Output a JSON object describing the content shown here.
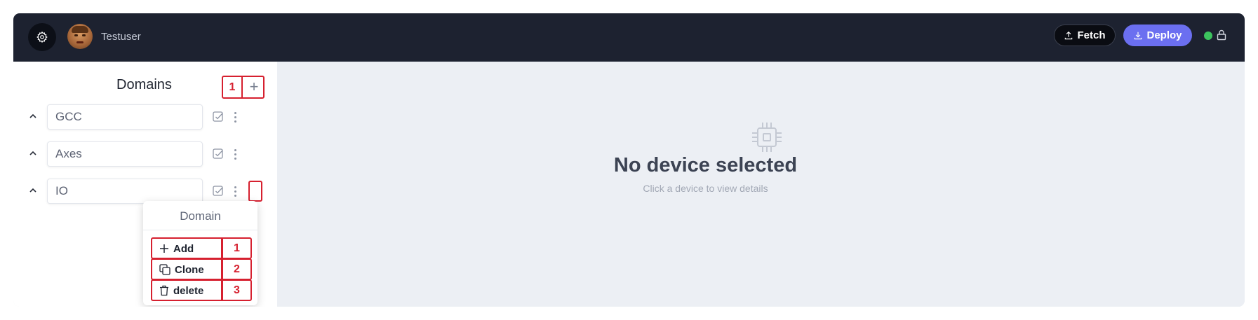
{
  "header": {
    "username": "Testuser",
    "fetch_label": "Fetch",
    "deploy_label": "Deploy",
    "status_color": "#3cc45e",
    "deploy_color": "#6b6ff0"
  },
  "sidebar": {
    "title": "Domains",
    "title_annotation": "1",
    "add_icon": "plus-icon",
    "domains": [
      {
        "name": "GCC"
      },
      {
        "name": "Axes"
      },
      {
        "name": "IO"
      }
    ]
  },
  "context_menu": {
    "title": "Domain",
    "items": [
      {
        "label": "Add",
        "icon": "plus-icon",
        "annotation": "1"
      },
      {
        "label": "Clone",
        "icon": "clone-icon",
        "annotation": "2"
      },
      {
        "label": "delete",
        "icon": "trash-icon",
        "annotation": "3"
      }
    ]
  },
  "main": {
    "empty_title": "No device selected",
    "empty_subtitle": "Click a device to view details",
    "empty_icon": "chip-icon"
  },
  "annotation_color": "#d6202f"
}
